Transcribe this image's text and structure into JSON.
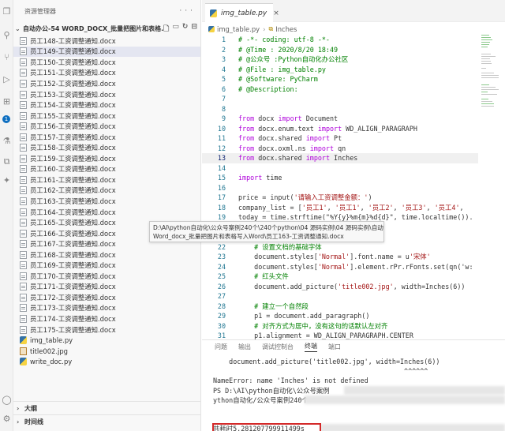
{
  "sidebar": {
    "title": "资源管理器",
    "header_actions": "···",
    "folder_name": "自动办公-54 WORD_DOCX_批量把图片和表格...",
    "files": [
      {
        "name": "员工148-工资调整通知.docx",
        "type": "docx"
      },
      {
        "name": "员工149-工资调整通知.docx",
        "type": "docx"
      },
      {
        "name": "员工150-工资调整通知.docx",
        "type": "docx"
      },
      {
        "name": "员工151-工资调整通知.docx",
        "type": "docx"
      },
      {
        "name": "员工152-工资调整通知.docx",
        "type": "docx"
      },
      {
        "name": "员工153-工资调整通知.docx",
        "type": "docx"
      },
      {
        "name": "员工154-工资调整通知.docx",
        "type": "docx"
      },
      {
        "name": "员工155-工资调整通知.docx",
        "type": "docx"
      },
      {
        "name": "员工156-工资调整通知.docx",
        "type": "docx"
      },
      {
        "name": "员工157-工资调整通知.docx",
        "type": "docx"
      },
      {
        "name": "员工158-工资调整通知.docx",
        "type": "docx"
      },
      {
        "name": "员工159-工资调整通知.docx",
        "type": "docx"
      },
      {
        "name": "员工160-工资调整通知.docx",
        "type": "docx"
      },
      {
        "name": "员工161-工资调整通知.docx",
        "type": "docx"
      },
      {
        "name": "员工162-工资调整通知.docx",
        "type": "docx"
      },
      {
        "name": "员工163-工资调整通知.docx",
        "type": "docx"
      },
      {
        "name": "员工164-工资调整通知.docx",
        "type": "docx"
      },
      {
        "name": "员工165-工资调整通知.docx",
        "type": "docx"
      },
      {
        "name": "员工166-工资调整通知.docx",
        "type": "docx"
      },
      {
        "name": "员工167-工资调整通知.docx",
        "type": "docx"
      },
      {
        "name": "员工168-工资调整通知.docx",
        "type": "docx"
      },
      {
        "name": "员工169-工资调整通知.docx",
        "type": "docx"
      },
      {
        "name": "员工170-工资调整通知.docx",
        "type": "docx"
      },
      {
        "name": "员工171-工资调整通知.docx",
        "type": "docx"
      },
      {
        "name": "员工172-工资调整通知.docx",
        "type": "docx"
      },
      {
        "name": "员工173-工资调整通知.docx",
        "type": "docx"
      },
      {
        "name": "员工174-工资调整通知.docx",
        "type": "docx"
      },
      {
        "name": "员工175-工资调整通知.docx",
        "type": "docx"
      },
      {
        "name": "img_table.py",
        "type": "py"
      },
      {
        "name": "title002.jpg",
        "type": "jpg"
      },
      {
        "name": "write_doc.py",
        "type": "py"
      }
    ],
    "outline_label": "大纲",
    "timeline_label": "时间线"
  },
  "editor": {
    "tab_label": "img_table.py",
    "tab_close": "×",
    "breadcrumb_file": "img_table.py",
    "breadcrumb_symbol": "Inches",
    "lines": [
      {
        "n": "1",
        "text": "# -*- coding: utf-8 -*-",
        "kind": "comment"
      },
      {
        "n": "2",
        "text": "# @Time : 2020/8/20 18:49",
        "kind": "comment"
      },
      {
        "n": "3",
        "text": "# @公众号 :Python自动化办公社区",
        "kind": "comment"
      },
      {
        "n": "4",
        "text": "# @File : img_table.py",
        "kind": "comment"
      },
      {
        "n": "5",
        "text": "# @Software: PyCharm",
        "kind": "comment"
      },
      {
        "n": "6",
        "text": "# @Description:",
        "kind": "comment"
      },
      {
        "n": "7",
        "text": "",
        "kind": "plain"
      },
      {
        "n": "8",
        "text": "",
        "kind": "plain"
      },
      {
        "n": "9",
        "text": "from docx import Document",
        "kind": "import"
      },
      {
        "n": "10",
        "text": "from docx.enum.text import WD_ALIGN_PARAGRAPH",
        "kind": "import"
      },
      {
        "n": "11",
        "text": "from docx.shared import Pt",
        "kind": "import"
      },
      {
        "n": "12",
        "text": "from docx.oxml.ns import qn",
        "kind": "import"
      },
      {
        "n": "13",
        "text": "from docx.shared import Inches",
        "kind": "import"
      },
      {
        "n": "14",
        "text": "",
        "kind": "plain"
      },
      {
        "n": "15",
        "text": "import time",
        "kind": "import"
      },
      {
        "n": "16",
        "text": "",
        "kind": "plain"
      },
      {
        "n": "17",
        "text": "price = input('请输入工资调整金额：')",
        "kind": "plain"
      },
      {
        "n": "18",
        "text": "company_list = ['员工1', '员工1', '员工2', '员工3', '员工4',",
        "kind": "plain"
      },
      {
        "n": "19",
        "text": "today = time.strftime(\"%Y{y}%m{m}%d{d}\", time.localtime()).",
        "kind": "plain"
      },
      {
        "n": "20",
        "text": "",
        "kind": "plain"
      },
      {
        "n": "21",
        "text": "",
        "kind": "plain"
      },
      {
        "n": "22",
        "text": "    # 设置文档的基础字体",
        "kind": "comment"
      },
      {
        "n": "23",
        "text": "    document.styles['Normal'].font.name = u'宋体'",
        "kind": "plain"
      },
      {
        "n": "24",
        "text": "    document.styles['Normal'].element.rPr.rFonts.set(qn('w:",
        "kind": "plain"
      },
      {
        "n": "25",
        "text": "    # 红头文件",
        "kind": "comment"
      },
      {
        "n": "26",
        "text": "    document.add_picture('title002.jpg', width=Inches(6))",
        "kind": "plain"
      },
      {
        "n": "27",
        "text": "",
        "kind": "plain"
      },
      {
        "n": "28",
        "text": "    # 建立一个自然段",
        "kind": "comment"
      },
      {
        "n": "29",
        "text": "    p1 = document.add_paragraph()",
        "kind": "plain"
      },
      {
        "n": "30",
        "text": "    # 对齐方式为居中，没有这句的话默认左对齐",
        "kind": "comment"
      },
      {
        "n": "31",
        "text": "    p1.alignment = WD_ALIGN_PARAGRAPH.CENTER",
        "kind": "plain"
      }
    ]
  },
  "tooltip": {
    "line1": "D:\\AI\\python自动化\\公众号案例240个\\240个python\\04 源码实例\\04 源码实例\\自动办公-54",
    "line2": "Word_docx_批量把图片和表格写入Word\\员工163-工资调整通知.docx"
  },
  "panel": {
    "tabs": [
      "问题",
      "输出",
      "调试控制台",
      "终端",
      "端口"
    ],
    "active_tab": "终端",
    "terminal_lines": [
      "    document.add_picture('title002.jpg', width=Inches(6))",
      "                                                ^^^^^^",
      "NameError: name 'Inches' is not defined",
      "PS D:\\AI\\python自动化\\公众号案例",
      "ython自动化/公众号案例240个",
      "共耗时5.281207799911499s",
      "PS D:\\AI\\python自动化\\公众"
    ]
  },
  "colors": {
    "accent": "#0e6fc0",
    "highlight_border": "#d42a2a",
    "comment": "#008000",
    "keyword": "#af00db",
    "string": "#a31515"
  }
}
